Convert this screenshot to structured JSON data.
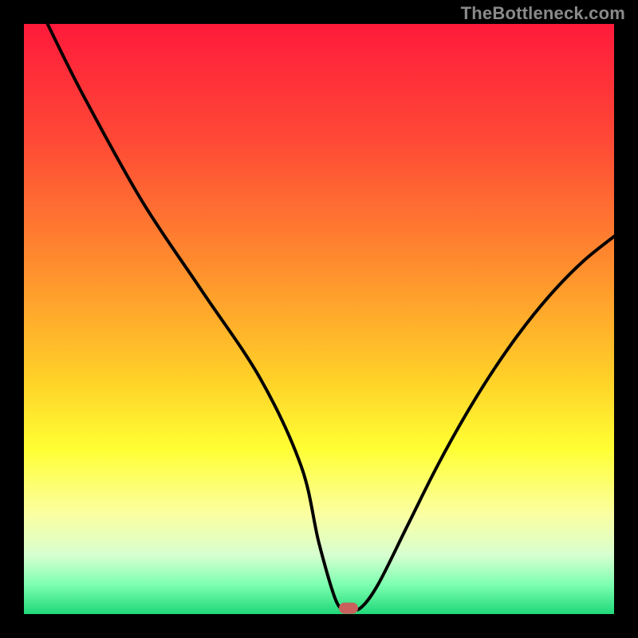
{
  "watermark": "TheBottleneck.com",
  "chart_data": {
    "type": "line",
    "title": "",
    "xlabel": "",
    "ylabel": "",
    "xlim": [
      0,
      100
    ],
    "ylim": [
      0,
      100
    ],
    "x": [
      4,
      10,
      20,
      30,
      40,
      47,
      50,
      53,
      55,
      57,
      60,
      65,
      70,
      75,
      80,
      85,
      90,
      95,
      100
    ],
    "y": [
      100,
      88,
      70,
      55,
      40,
      25,
      12,
      2,
      1,
      1,
      5,
      15,
      25,
      34,
      42,
      49,
      55,
      60,
      64
    ],
    "optimum_x": 55,
    "gradient_stops": [
      {
        "offset": 0.0,
        "color": "#ff1a3b"
      },
      {
        "offset": 0.2,
        "color": "#ff4a36"
      },
      {
        "offset": 0.4,
        "color": "#ff8a2e"
      },
      {
        "offset": 0.6,
        "color": "#ffd028"
      },
      {
        "offset": 0.72,
        "color": "#ffff33"
      },
      {
        "offset": 0.83,
        "color": "#fbffa0"
      },
      {
        "offset": 0.9,
        "color": "#d7ffd0"
      },
      {
        "offset": 0.95,
        "color": "#7dffb0"
      },
      {
        "offset": 1.0,
        "color": "#1fd879"
      }
    ],
    "marker": {
      "x": 55,
      "y": 1,
      "color": "#c9605d"
    },
    "border_px": 30
  }
}
